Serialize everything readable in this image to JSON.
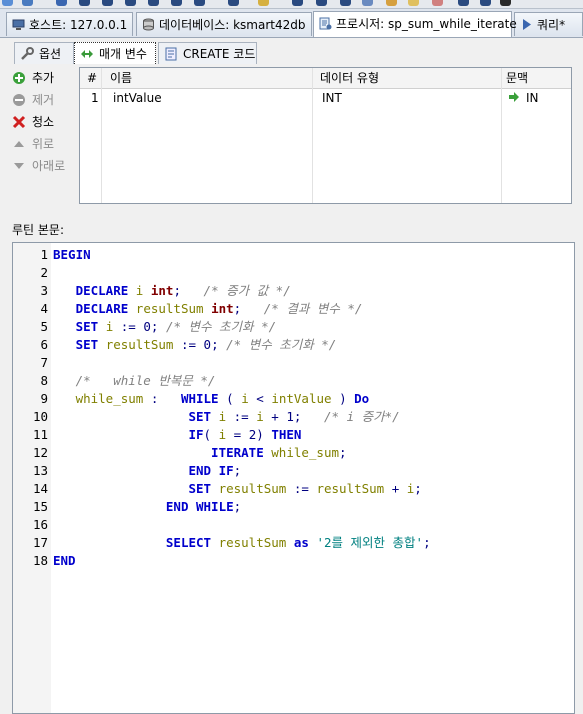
{
  "window": {
    "tabs": [
      {
        "label": "호스트: 127.0.0.1",
        "icon": "server-icon"
      },
      {
        "label": "데이터베이스: ksmart42db",
        "icon": "database-icon"
      },
      {
        "label": "프로시저: sp_sum_while_iterate",
        "icon": "procedure-icon"
      },
      {
        "label": "쿼리*",
        "icon": "query-icon"
      }
    ]
  },
  "subtabs": [
    {
      "label": "옵션",
      "icon": "wrench-icon"
    },
    {
      "label": "매개 변수",
      "icon": "parameters-icon"
    },
    {
      "label": "CREATE 코드",
      "icon": "code-icon"
    }
  ],
  "side_buttons": [
    {
      "label": "추가",
      "icon": "add-icon",
      "enabled": true
    },
    {
      "label": "제거",
      "icon": "remove-icon",
      "enabled": false
    },
    {
      "label": "청소",
      "icon": "clear-icon",
      "enabled": true
    },
    {
      "label": "위로",
      "icon": "up-arrow-icon",
      "enabled": false
    },
    {
      "label": "아래로",
      "icon": "down-arrow-icon",
      "enabled": false
    }
  ],
  "params_table": {
    "headers": [
      "#",
      "이름",
      "데이터 유형",
      "문맥"
    ],
    "rows": [
      {
        "num": "1",
        "name": "intValue",
        "type": "INT",
        "context": "IN"
      }
    ]
  },
  "routine_label": "루틴 본문:",
  "code_lines": [
    {
      "n": "1",
      "text": "BEGIN"
    },
    {
      "n": "2",
      "text": ""
    },
    {
      "n": "3",
      "text": "   DECLARE i int;   /* 증가 값 */"
    },
    {
      "n": "4",
      "text": "   DECLARE resultSum int;   /* 결과 변수 */"
    },
    {
      "n": "5",
      "text": "   SET i := 0; /* 변수 초기화 */"
    },
    {
      "n": "6",
      "text": "   SET resultSum := 0; /* 변수 초기화 */"
    },
    {
      "n": "7",
      "text": ""
    },
    {
      "n": "8",
      "text": "   /*   while 반복문 */"
    },
    {
      "n": "9",
      "text": "   while_sum :   WHILE ( i < intValue ) Do"
    },
    {
      "n": "10",
      "text": "                  SET i := i + 1;   /* i 증가*/"
    },
    {
      "n": "11",
      "text": "                  IF( i = 2) THEN"
    },
    {
      "n": "12",
      "text": "                     ITERATE while_sum;"
    },
    {
      "n": "13",
      "text": "                  END IF;"
    },
    {
      "n": "14",
      "text": "                  SET resultSum := resultSum + i;"
    },
    {
      "n": "15",
      "text": "               END WHILE;"
    },
    {
      "n": "16",
      "text": ""
    },
    {
      "n": "17",
      "text": "               SELECT resultSum as '2를 제외한 총합';"
    },
    {
      "n": "18",
      "text": "END"
    }
  ]
}
